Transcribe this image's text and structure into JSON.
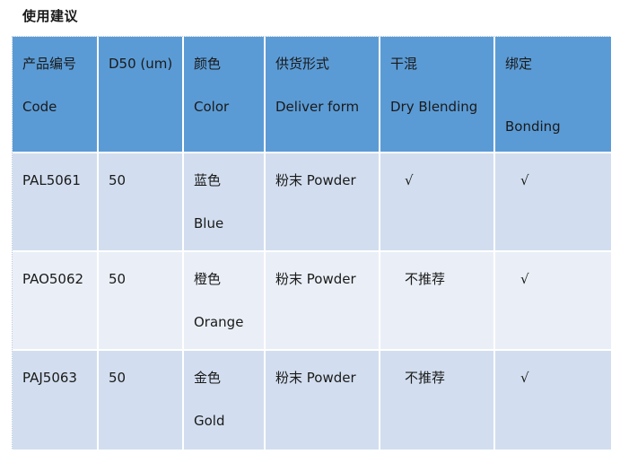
{
  "title": "使用建议",
  "table": {
    "headers": [
      {
        "cn": "产品编号",
        "en": "Code"
      },
      {
        "cn": "D50 (um)",
        "en": ""
      },
      {
        "cn": "颜色",
        "en": "Color"
      },
      {
        "cn": "供货形式",
        "en": "Deliver form"
      },
      {
        "cn": "干混",
        "en": "Dry Blending"
      },
      {
        "cn": "绑定",
        "en": "Bonding"
      }
    ],
    "rows": [
      {
        "code": "PAL5061",
        "d50": "50",
        "color_cn": "蓝色",
        "color_en": "Blue",
        "form": "粉末 Powder",
        "dry_blending": "√",
        "bonding": "√"
      },
      {
        "code": "PAO5062",
        "d50": "50",
        "color_cn": "橙色",
        "color_en": "Orange",
        "form": "粉末 Powder",
        "dry_blending": "不推荐",
        "bonding": "√"
      },
      {
        "code": "PAJ5063",
        "d50": "50",
        "color_cn": "金色",
        "color_en": "Gold",
        "form": "粉末 Powder",
        "dry_blending": "不推荐",
        "bonding": "√"
      }
    ]
  },
  "colors": {
    "header_bg": "#5b9bd5",
    "row_odd_bg": "#d2deef",
    "row_even_bg": "#eaeff7"
  }
}
